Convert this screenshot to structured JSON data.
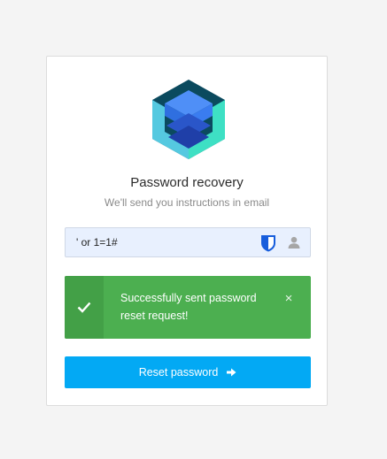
{
  "recovery": {
    "title": "Password recovery",
    "subtitle": "We'll send you instructions in email",
    "email_value": "' or 1=1#",
    "alert": {
      "message": "Successfully sent password reset request!",
      "close_symbol": "×"
    },
    "reset_button_label": "Reset password"
  },
  "icons": {
    "logo": "stacked-layers-hexagon-logo",
    "field_extension": "bitwarden-shield-icon",
    "field_user": "user-icon",
    "alert_status": "check-icon",
    "alert_close": "close-icon",
    "button_arrow": "arrow-right-icon"
  },
  "colors": {
    "page_background": "#f4f4f4",
    "card_background": "#ffffff",
    "input_background": "#e8f0fe",
    "success": "#4caf50",
    "success_dark": "#43a047",
    "primary": "#03a9f4",
    "logo_dark": "#0b4a5e",
    "logo_teal": "#45d6c6",
    "logo_blue": "#3b82f6"
  }
}
